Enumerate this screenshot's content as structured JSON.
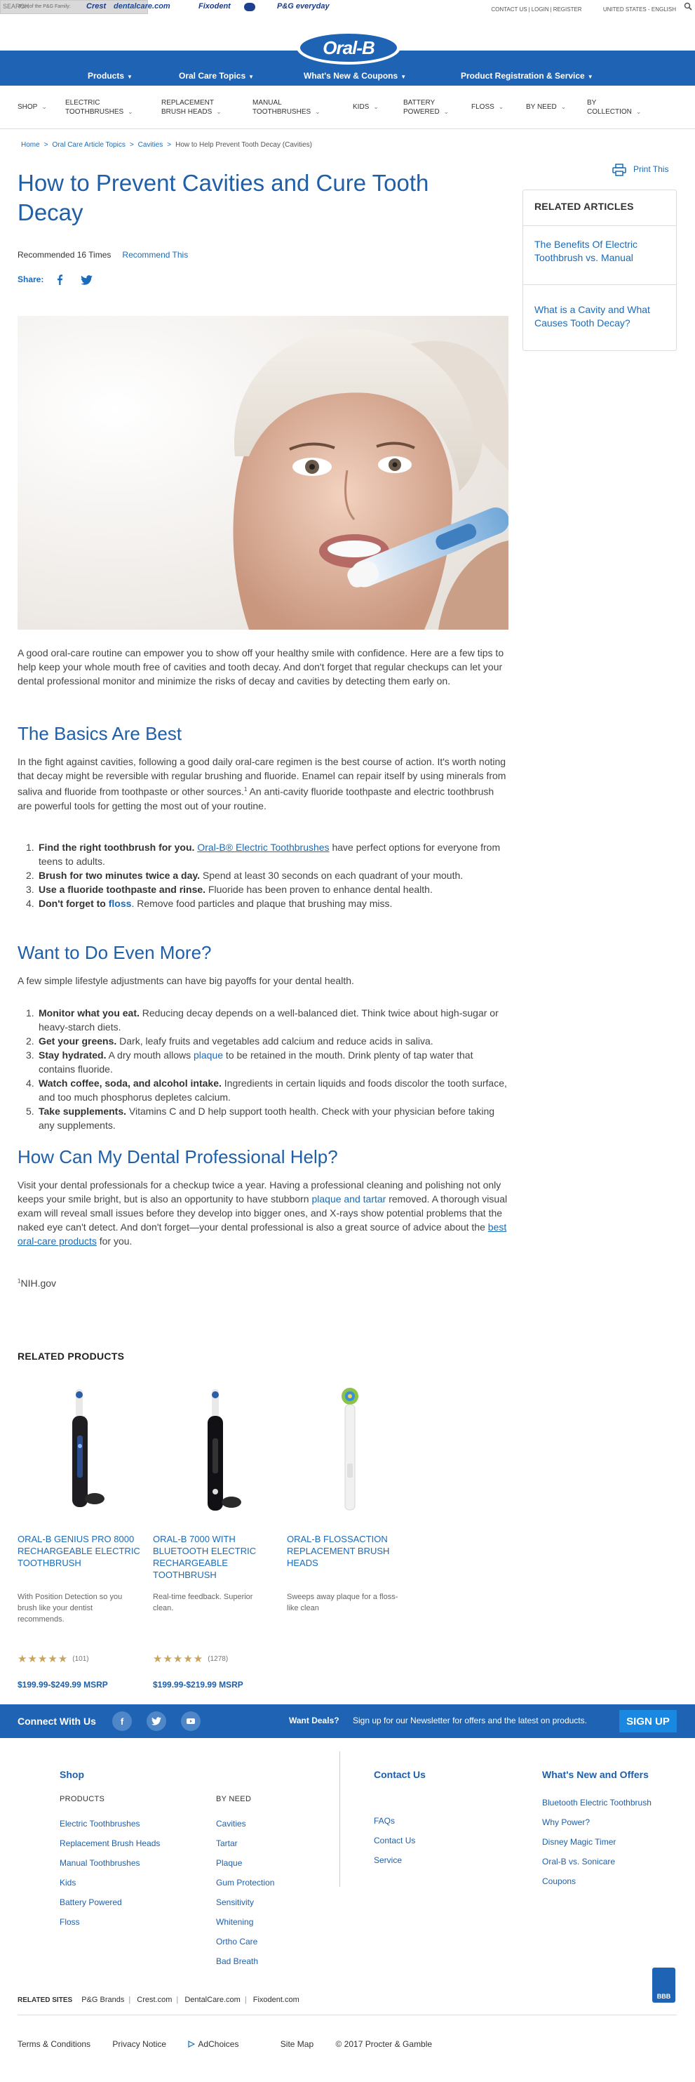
{
  "topbar": {
    "pg_family": "Part of the P&G Family:",
    "brands": [
      "Crest",
      "dentalcare.com",
      "Fixodent",
      "Oral-B",
      "P&G everyday"
    ],
    "links": [
      "CONTACT US",
      "LOGIN",
      "REGISTER"
    ],
    "region": "UNITED STATES - ENGLISH",
    "search_placeholder": "SEARCH"
  },
  "logo": "Oral-B",
  "mainnav": [
    "Products",
    "Oral Care Topics",
    "What's New & Coupons",
    "Product Registration & Service"
  ],
  "catnav": [
    {
      "line1": "SHOP",
      "line2": ""
    },
    {
      "line1": "ELECTRIC",
      "line2": "TOOTHBRUSHES"
    },
    {
      "line1": "REPLACEMENT",
      "line2": "BRUSH HEADS"
    },
    {
      "line1": "MANUAL",
      "line2": "TOOTHBRUSHES"
    },
    {
      "line1": "KIDS",
      "line2": ""
    },
    {
      "line1": "BATTERY",
      "line2": "POWERED"
    },
    {
      "line1": "FLOSS",
      "line2": ""
    },
    {
      "line1": "BY NEED",
      "line2": ""
    },
    {
      "line1": "BY",
      "line2": "COLLECTION"
    }
  ],
  "breadcrumb": [
    "Home",
    "Oral Care Article Topics",
    "Cavities",
    "How to Help Prevent Tooth Decay (Cavities)"
  ],
  "print_label": "Print This",
  "related_articles": {
    "title": "RELATED ARTICLES",
    "items": [
      "The Benefits Of Electric Toothbrush vs. Manual",
      "What is a Cavity and What Causes Tooth Decay?"
    ]
  },
  "article": {
    "title": "How to Prevent Cavities and Cure Tooth Decay",
    "recommended": "Recommended 16 Times",
    "recommend_link": "Recommend This",
    "share_label": "Share:",
    "intro": "A good oral-care routine can empower you to show off your healthy smile with confidence. Here are a few tips to help keep your whole mouth free of cavities and tooth decay. And don't forget that regular checkups can let your dental professional monitor and minimize the risks of decay and cavities by detecting them early on.",
    "sections": [
      {
        "heading": "The Basics Are Best",
        "body": "In the fight against cavities, following a good daily oral-care regimen is the best course of action. It's worth noting that decay might be reversible with regular brushing and fluoride. Enamel can repair itself by using minerals from saliva and fluoride from toothpaste or other sources.",
        "body_sup": "1",
        "body_rest": " An anti-cavity fluoride toothpaste and electric toothbrush are powerful tools for getting the most out of your routine.",
        "list": [
          {
            "bold": "Find the right toothbrush for you.",
            "link": "Oral-B® Electric Toothbrushes",
            "text": " have perfect options for everyone from teens to adults."
          },
          {
            "bold": "Brush for two minutes twice a day.",
            "link": "",
            "text": " Spend at least 30 seconds on each quadrant of your mouth."
          },
          {
            "bold": "Use a fluoride toothpaste and rinse.",
            "link": "",
            "text": " Fluoride has been proven to enhance dental health."
          },
          {
            "bold": "Don't forget to ",
            "link": "floss",
            "text": ". Remove food particles and plaque that brushing may miss."
          }
        ]
      },
      {
        "heading": "Want to Do Even More?",
        "body": "A few simple lifestyle adjustments can have big payoffs for your dental health.",
        "list": [
          {
            "bold": "Monitor what you eat.",
            "text": " Reducing decay depends on a well-balanced diet. Think twice about high-sugar or heavy-starch diets."
          },
          {
            "bold": "Get your greens.",
            "text": " Dark, leafy fruits and vegetables add calcium and reduce acids in saliva."
          },
          {
            "bold": "Stay hydrated.",
            "text_a": " A dry mouth allows ",
            "link": "plaque",
            "text": " to be retained in the mouth. Drink plenty of tap water that contains fluoride."
          },
          {
            "bold": "Watch coffee, soda, and alcohol intake.",
            "text": " Ingredients in certain liquids and foods discolor the tooth surface, and too much phosphorus depletes calcium."
          },
          {
            "bold": "Take supplements.",
            "text": " Vitamins C and D help support tooth health. Check with your physician before taking any supplements."
          }
        ]
      },
      {
        "heading": "How Can My Dental Professional Help?",
        "body_a": "Visit your dental professionals for a checkup twice a year. Having a professional cleaning and polishing not only keeps your smile bright, but is also an opportunity to have stubborn ",
        "link_a": "plaque and tartar",
        "body_b": " removed. A thorough visual exam will reveal small issues before they develop into bigger ones, and X-rays show potential problems that the naked eye can't detect. And don't forget—your dental professional is also a great source of advice about the ",
        "link_b": "best oral-care products",
        "body_c": " for you."
      }
    ],
    "footnote_num": "1",
    "footnote": "NIH.gov"
  },
  "related_products": {
    "title": "RELATED PRODUCTS",
    "items": [
      {
        "name": "ORAL-B GENIUS PRO 8000 RECHARGEABLE ELECTRIC TOOTHBRUSH",
        "desc": "With Position Detection so you brush like your dentist recommends.",
        "rating": 5,
        "count": "(101)",
        "price": "$199.99-$249.99 MSRP"
      },
      {
        "name": "ORAL-B 7000 WITH BLUETOOTH ELECTRIC RECHARGEABLE TOOTHBRUSH",
        "desc": "Real-time feedback. Superior clean.",
        "rating": 5,
        "count": "(1278)",
        "price": "$199.99-$219.99 MSRP"
      },
      {
        "name": "ORAL-B FLOSSACTION REPLACEMENT BRUSH HEADS",
        "desc": "Sweeps away plaque for a floss-like clean",
        "rating": null,
        "count": "",
        "price": ""
      }
    ]
  },
  "connect": {
    "label": "Connect With Us",
    "deals": "Want Deals?",
    "newsletter": "Sign up for our Newsletter for offers and the latest on products.",
    "signup": "SIGN UP"
  },
  "footer": {
    "shop": "Shop",
    "products_head": "PRODUCTS",
    "products": [
      "Electric Toothbrushes",
      "Replacement Brush Heads",
      "Manual Toothbrushes",
      "Kids",
      "Battery Powered",
      "Floss"
    ],
    "byneed_head": "BY NEED",
    "byneed": [
      "Cavities",
      "Tartar",
      "Plaque",
      "Gum Protection",
      "Sensitivity",
      "Whitening",
      "Ortho Care",
      "Bad Breath"
    ],
    "contact": "Contact Us",
    "contact_items": [
      "FAQs",
      "Contact Us",
      "Service"
    ],
    "whatsnew": "What's New and Offers",
    "whatsnew_items": [
      "Bluetooth Electric Toothbrush",
      "Why Power?",
      "Disney Magic Timer",
      "Oral-B vs. Sonicare",
      "Coupons"
    ],
    "related_sites_label": "RELATED SITES",
    "related_sites": [
      "P&G Brands",
      "Crest.com",
      "DentalCare.com",
      "Fixodent.com"
    ],
    "legal": [
      "Terms & Conditions",
      "Privacy Notice",
      "AdChoices",
      "Site Map",
      "© 2017 Procter & Gamble"
    ],
    "bbb": "BBB"
  },
  "colors": {
    "brand_blue": "#1f63b4",
    "link_blue": "#1a6bb8",
    "star_gold": "#c9a45c"
  }
}
